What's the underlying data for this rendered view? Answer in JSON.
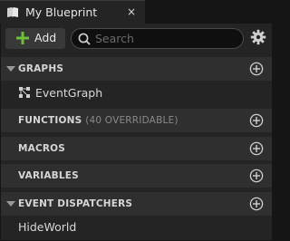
{
  "tab": {
    "title": "My Blueprint",
    "close_glyph": "×",
    "icon": "book-icon"
  },
  "toolbar": {
    "add_label": "Add",
    "search_placeholder": "Search",
    "accent": "#6fbf3a"
  },
  "categories": [
    {
      "title": "GRAPHS",
      "expanded": true,
      "items": [
        {
          "label": "EventGraph",
          "icon": "graph-nodes-icon"
        }
      ]
    },
    {
      "title": "FUNCTIONS",
      "subtitle": "(40 OVERRIDABLE)",
      "expanded": false
    },
    {
      "title": "MACROS",
      "expanded": false
    },
    {
      "title": "VARIABLES",
      "expanded": false
    },
    {
      "title": "EVENT DISPATCHERS",
      "expanded": true,
      "items": [
        {
          "label": "HideWorld"
        }
      ]
    }
  ]
}
